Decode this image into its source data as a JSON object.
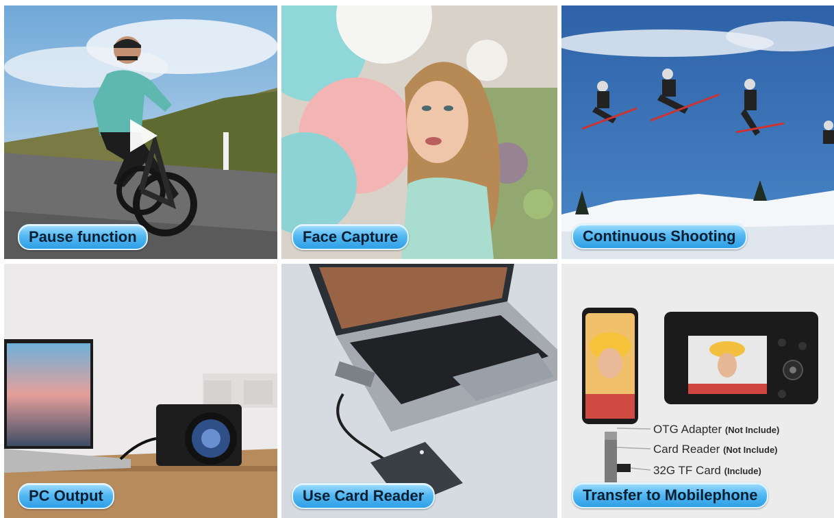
{
  "features": [
    {
      "caption": "Pause function"
    },
    {
      "caption": "Face Capture"
    },
    {
      "caption": "Continuous Shooting"
    },
    {
      "caption": "PC Output"
    },
    {
      "caption": "Use Card Reader"
    },
    {
      "caption": "Transfer to Mobilephone"
    }
  ],
  "transfer": {
    "otg_label": "OTG Adapter",
    "otg_note": "(Not Include)",
    "reader_label": "Card Reader",
    "reader_note": "(Not Include)",
    "card_label": "32G TF Card",
    "card_note": "(Include)"
  },
  "icons": {
    "play": "play-icon"
  },
  "colors": {
    "caption_fill": "#55b9f2",
    "caption_text": "#0b1f33"
  }
}
